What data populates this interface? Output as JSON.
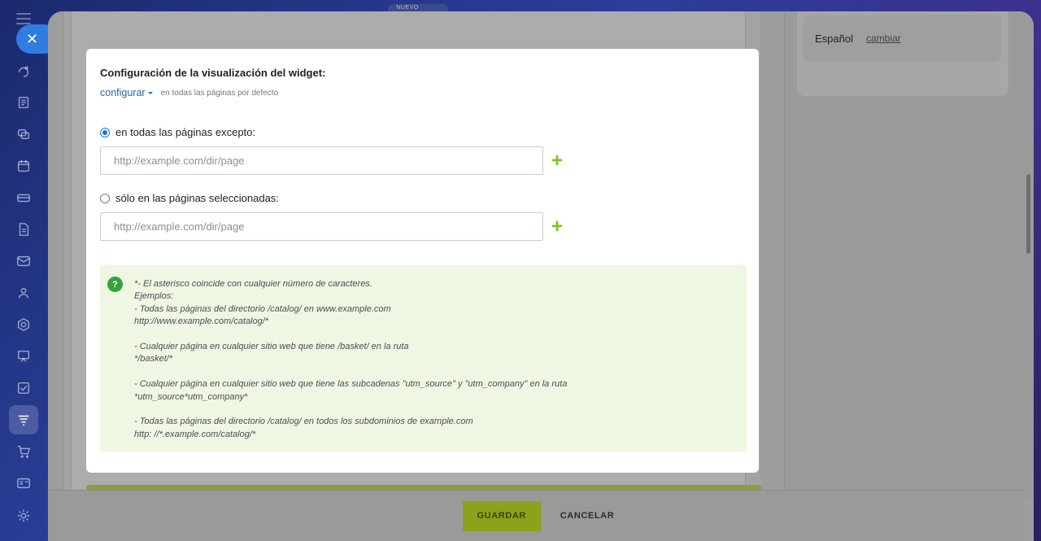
{
  "rail": {
    "icons": [
      "sparkle-icon",
      "tasks-icon",
      "chat-icon",
      "calendar-icon",
      "storage-icon",
      "document-icon",
      "mail-icon",
      "users-icon",
      "hexagon-icon",
      "presentation-icon",
      "checkbox-icon",
      "filter-icon",
      "cart-icon",
      "id-card-icon",
      "settings-icon"
    ],
    "active": "filter-icon"
  },
  "badge": "NUEVO",
  "language": {
    "label": "Español",
    "change_link": "cambiar"
  },
  "modal": {
    "title": "Configuración de la visualización del widget:",
    "configure_link": "configurar",
    "configure_hint": "en todas las páginas por defecto",
    "option_except": {
      "label": "en todas las páginas excepto:",
      "checked": true
    },
    "option_only": {
      "label": "sólo en las páginas seleccionadas:",
      "checked": false
    },
    "url_placeholder": "http://example.com/dir/page",
    "add_symbol": "+",
    "help_icon": "?",
    "help_lines": [
      "*- El asterisco coincide con cualquier número de caracteres.",
      "Ejemplos:",
      "- Todas las páginas del directorio /catalog/ en www.example.com",
      "http://www.example.com/catalog/*",
      "",
      "- Cualquier página en cualquier sitio web que tiene /basket/ en la ruta",
      "*/basket/*",
      "",
      "- Cualquier página en cualquier sitio web que tiene las subcadenas \"utm_source\" y \"utm_company\" en la ruta",
      "*utm_source*utm_company*",
      "",
      "- Todas las páginas del directorio /catalog/ en todos los subdominios de example.com",
      "http: //*.example.com/catalog/*"
    ]
  },
  "footer": {
    "save": "GUARDAR",
    "cancel": "CANCELAR"
  },
  "colors": {
    "save_button": "#8da11a",
    "link": "#2067b0",
    "plus": "#7cc31f",
    "help_bg": "#edf7e2",
    "accent": "#2f7de1"
  }
}
